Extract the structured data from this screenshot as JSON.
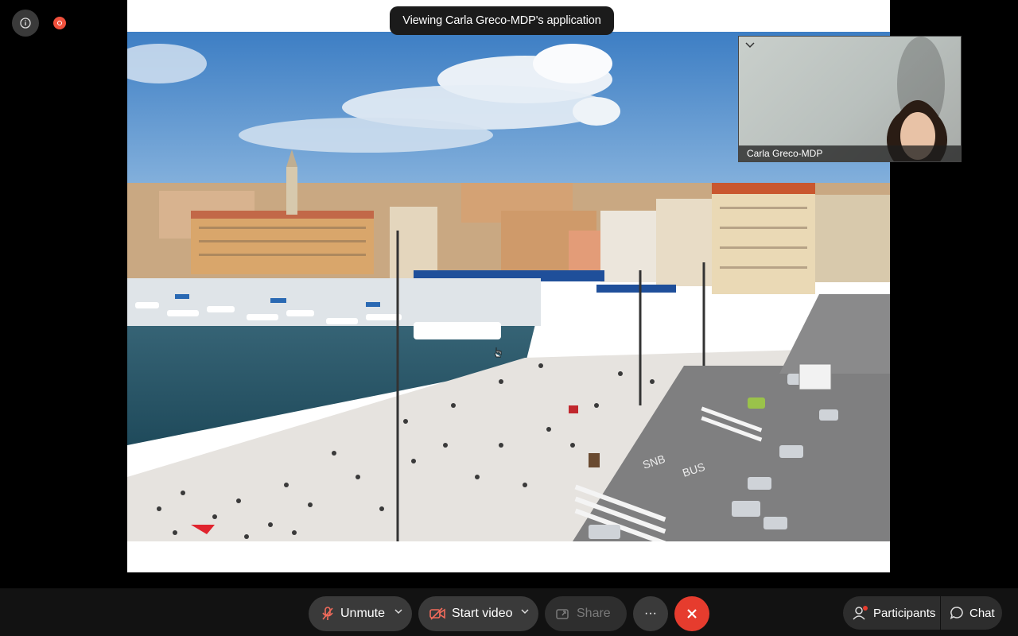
{
  "meeting": {
    "banner": "Viewing Carla Greco-MDP's application"
  },
  "self_view": {
    "name": "Carla Greco-MDP"
  },
  "shared_image": {
    "street_marking_1": "SNB",
    "street_marking_2": "BUS"
  },
  "controls": {
    "unmute_label": "Unmute",
    "start_video_label": "Start video",
    "share_label": "Share",
    "more_label": "···",
    "participants_label": "Participants",
    "chat_label": "Chat"
  },
  "colors": {
    "end_call": "#e63c2e",
    "recording": "#f0503c",
    "muted_icon": "#f26b5b",
    "notification_dot": "#e63c2e"
  }
}
